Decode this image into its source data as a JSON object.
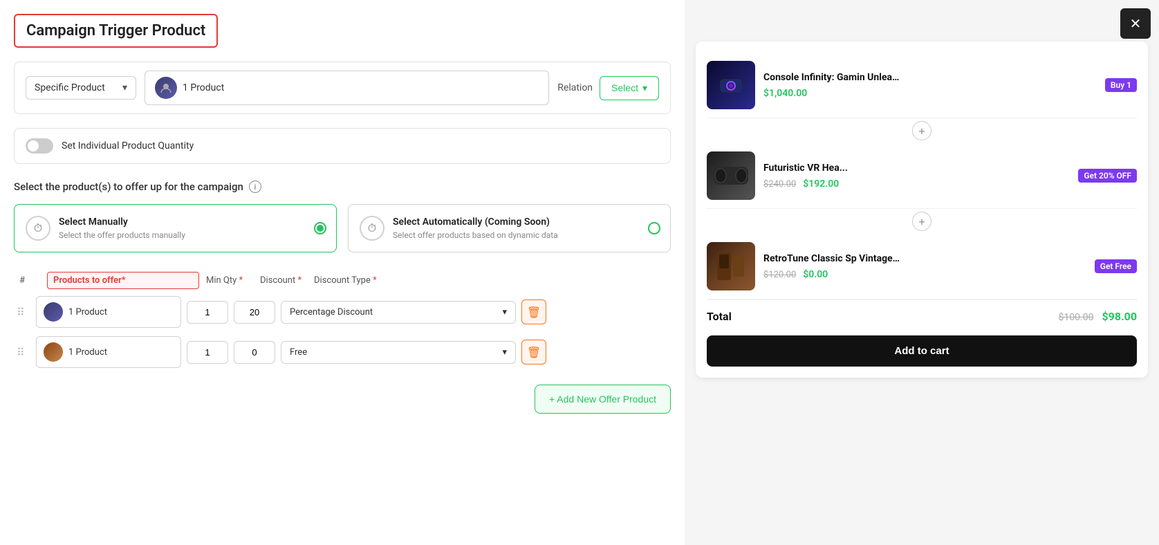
{
  "header": {
    "title": "Campaign Trigger Product"
  },
  "top_row": {
    "specific_product_label": "Specific Product",
    "product_count": "1 Product",
    "relation_label": "Relation",
    "select_btn_label": "Select"
  },
  "toggle": {
    "label": "Set Individual Product Quantity"
  },
  "offer_section": {
    "title": "Select the product(s) to offer up for the campaign",
    "manual_card": {
      "title": "Select Manually",
      "description": "Select the offer products manually"
    },
    "auto_card": {
      "title": "Select Automatically (Coming Soon)",
      "description": "Select offer products based on dynamic data"
    }
  },
  "table": {
    "col_hash": "#",
    "col_products": "Products to offer*",
    "col_minqty": "Min Qty *",
    "col_discount": "Discount *",
    "col_disctype": "Discount Type *",
    "rows": [
      {
        "product": "1 Product",
        "min_qty": "1",
        "discount": "20",
        "discount_type": "Percentage Discount"
      },
      {
        "product": "1 Product",
        "min_qty": "1",
        "discount": "0",
        "discount_type": "Free"
      }
    ],
    "add_btn": "+ Add New Offer Product"
  },
  "cart": {
    "products": [
      {
        "name": "Console Infinity: Gamin Unleashed",
        "price": "$1,040.00",
        "badge": "Buy 1",
        "badge_type": "buy"
      },
      {
        "name": "Futuristic VR Hea...",
        "price_old": "$240.00",
        "price_new": "$192.00",
        "badge": "Get 20% OFF",
        "badge_type": "off"
      },
      {
        "name": "RetroTune Classic Sp Vintage Charm",
        "price_old": "$120.00",
        "price_new": "$0.00",
        "badge": "Get Free",
        "badge_type": "free"
      }
    ],
    "total_label": "Total",
    "total_old": "$100.00",
    "total_new": "$98.00",
    "add_to_cart_label": "Add to cart"
  },
  "close_btn": "✕"
}
